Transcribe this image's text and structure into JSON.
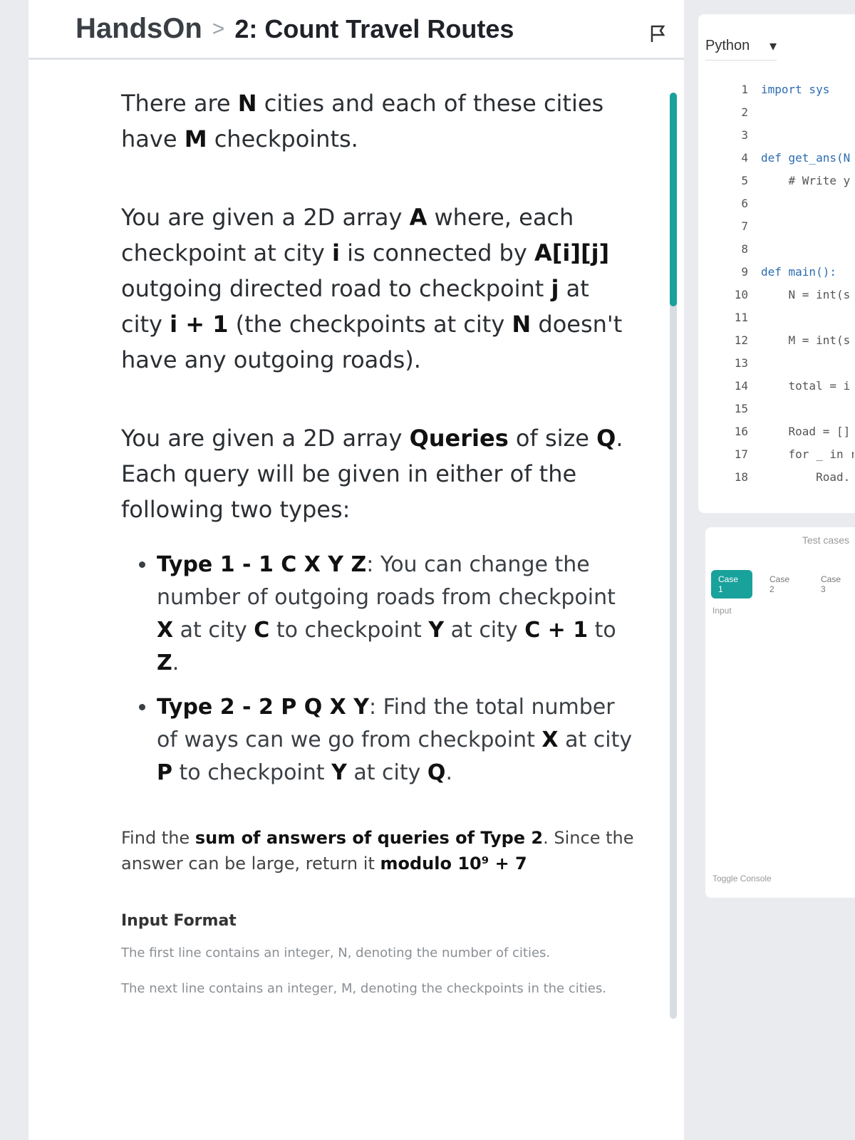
{
  "header": {
    "root": "HandsOn",
    "separator": ">",
    "title": "2: Count Travel Routes"
  },
  "problem": {
    "p1": [
      "There are ",
      "N",
      " cities and each of these cities have ",
      "M",
      " checkpoints."
    ],
    "p2": [
      "You are given a 2D array ",
      "A",
      " where, each checkpoint at city ",
      "i",
      " is connected by ",
      "A[i][j]",
      " outgoing directed road to checkpoint ",
      "j",
      " at city ",
      "i + 1",
      " (the checkpoints at city ",
      "N",
      " doesn't have any outgoing roads)."
    ],
    "p3": [
      "You are given a 2D array ",
      "Queries",
      " of size ",
      "Q",
      ". Each query will be given in either of the following two types:"
    ],
    "type1": [
      "Type 1 - 1 C X Y Z",
      ": You can change the number of outgoing roads from checkpoint ",
      "X",
      " at city ",
      "C",
      " to checkpoint ",
      "Y",
      " at city ",
      "C + 1",
      " to ",
      "Z",
      "."
    ],
    "type2": [
      "Type 2 - 2 P Q X Y",
      ": Find the total number of ways can we go from checkpoint ",
      "X",
      " at city ",
      "P",
      " to checkpoint ",
      "Y",
      " at city ",
      "Q",
      "."
    ],
    "find": [
      "Find the ",
      "sum of answers of queries of Type 2",
      ". Since the answer can be large, return it ",
      "modulo 10⁹ + 7"
    ],
    "input_format_title": "Input Format",
    "input_line1": "The first line contains an integer, N, denoting the number of cities.",
    "input_line2": "The next line contains an integer, M, denoting the checkpoints in the cities."
  },
  "editor": {
    "language": "Python",
    "line_numbers": [
      "1",
      "2",
      "3",
      "4",
      "5",
      "6",
      "7",
      "8",
      "9",
      "10",
      "11",
      "12",
      "13",
      "14",
      "15",
      "16",
      "17",
      "18"
    ],
    "code_lines": [
      "import sys",
      "",
      "",
      "def get_ans(N",
      "    # Write y",
      "",
      "",
      "",
      "def main():",
      "    N = int(s",
      "",
      "    M = int(s",
      "",
      "    total = i",
      "",
      "    Road = []",
      "    for _ in r",
      "        Road."
    ]
  },
  "tests": {
    "label": "Test cases",
    "tabs": [
      "Case 1",
      "Case 2",
      "Case 3"
    ],
    "input_label": "Input",
    "toggle_console": "Toggle Console"
  }
}
